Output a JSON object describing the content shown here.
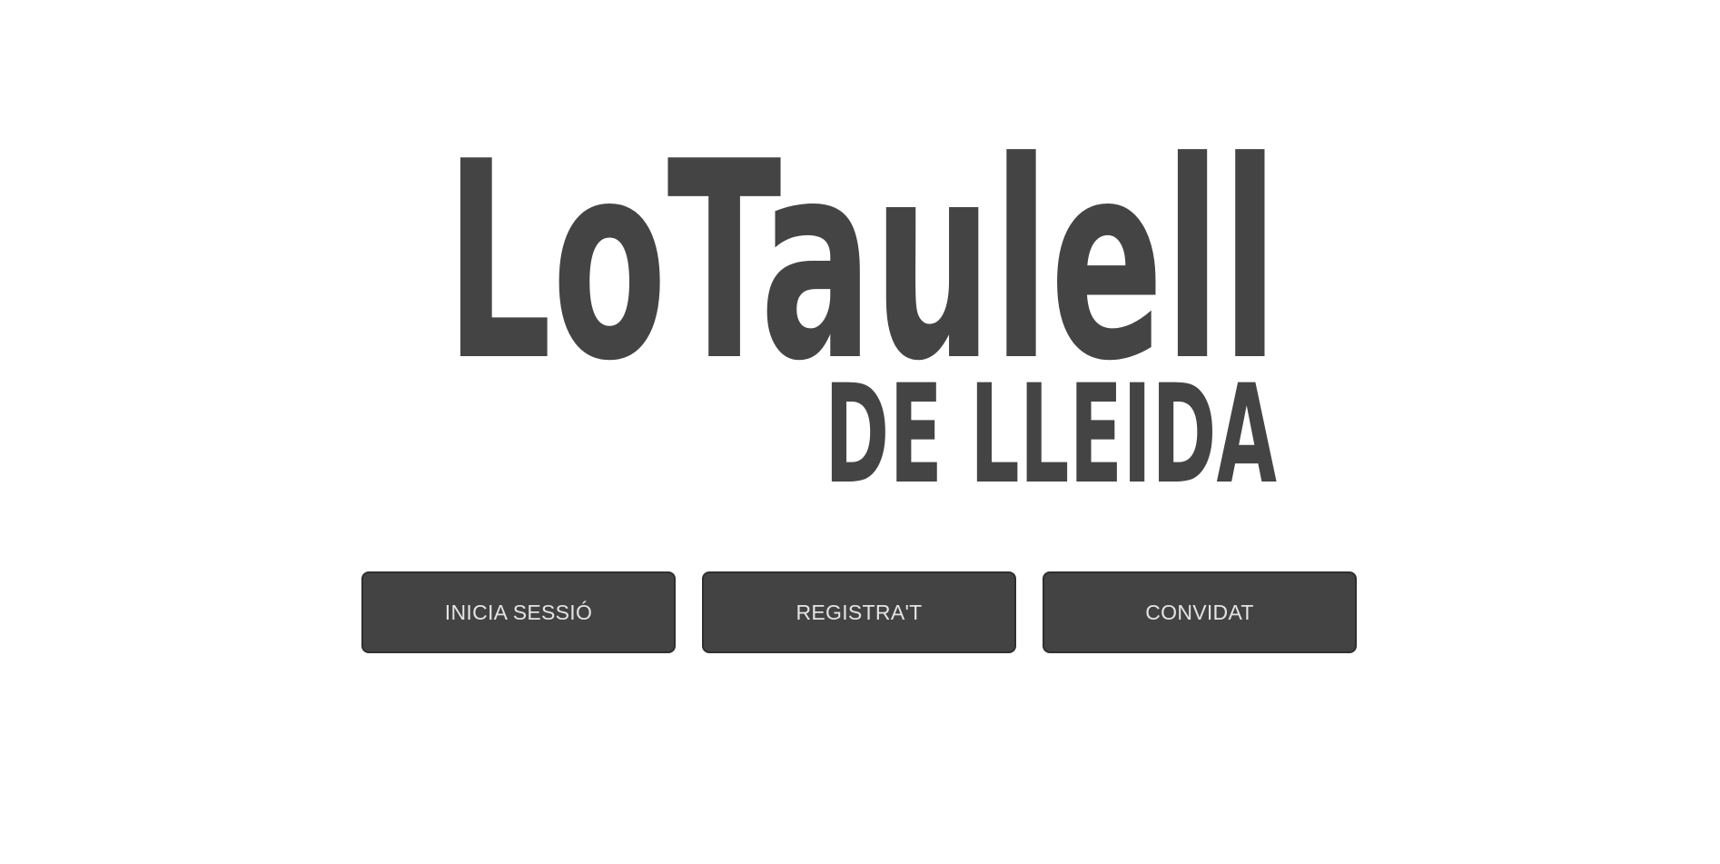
{
  "logo": {
    "line1": "LoTaulell",
    "line2": "DE LLEIDA",
    "color": "#444444"
  },
  "buttons": {
    "login": "INICIA SESSIÓ",
    "register": "REGISTRA'T",
    "guest": "CONVIDAT"
  },
  "colors": {
    "button_bg": "#434343",
    "button_text": "#e4e4e4",
    "background": "#ffffff"
  }
}
